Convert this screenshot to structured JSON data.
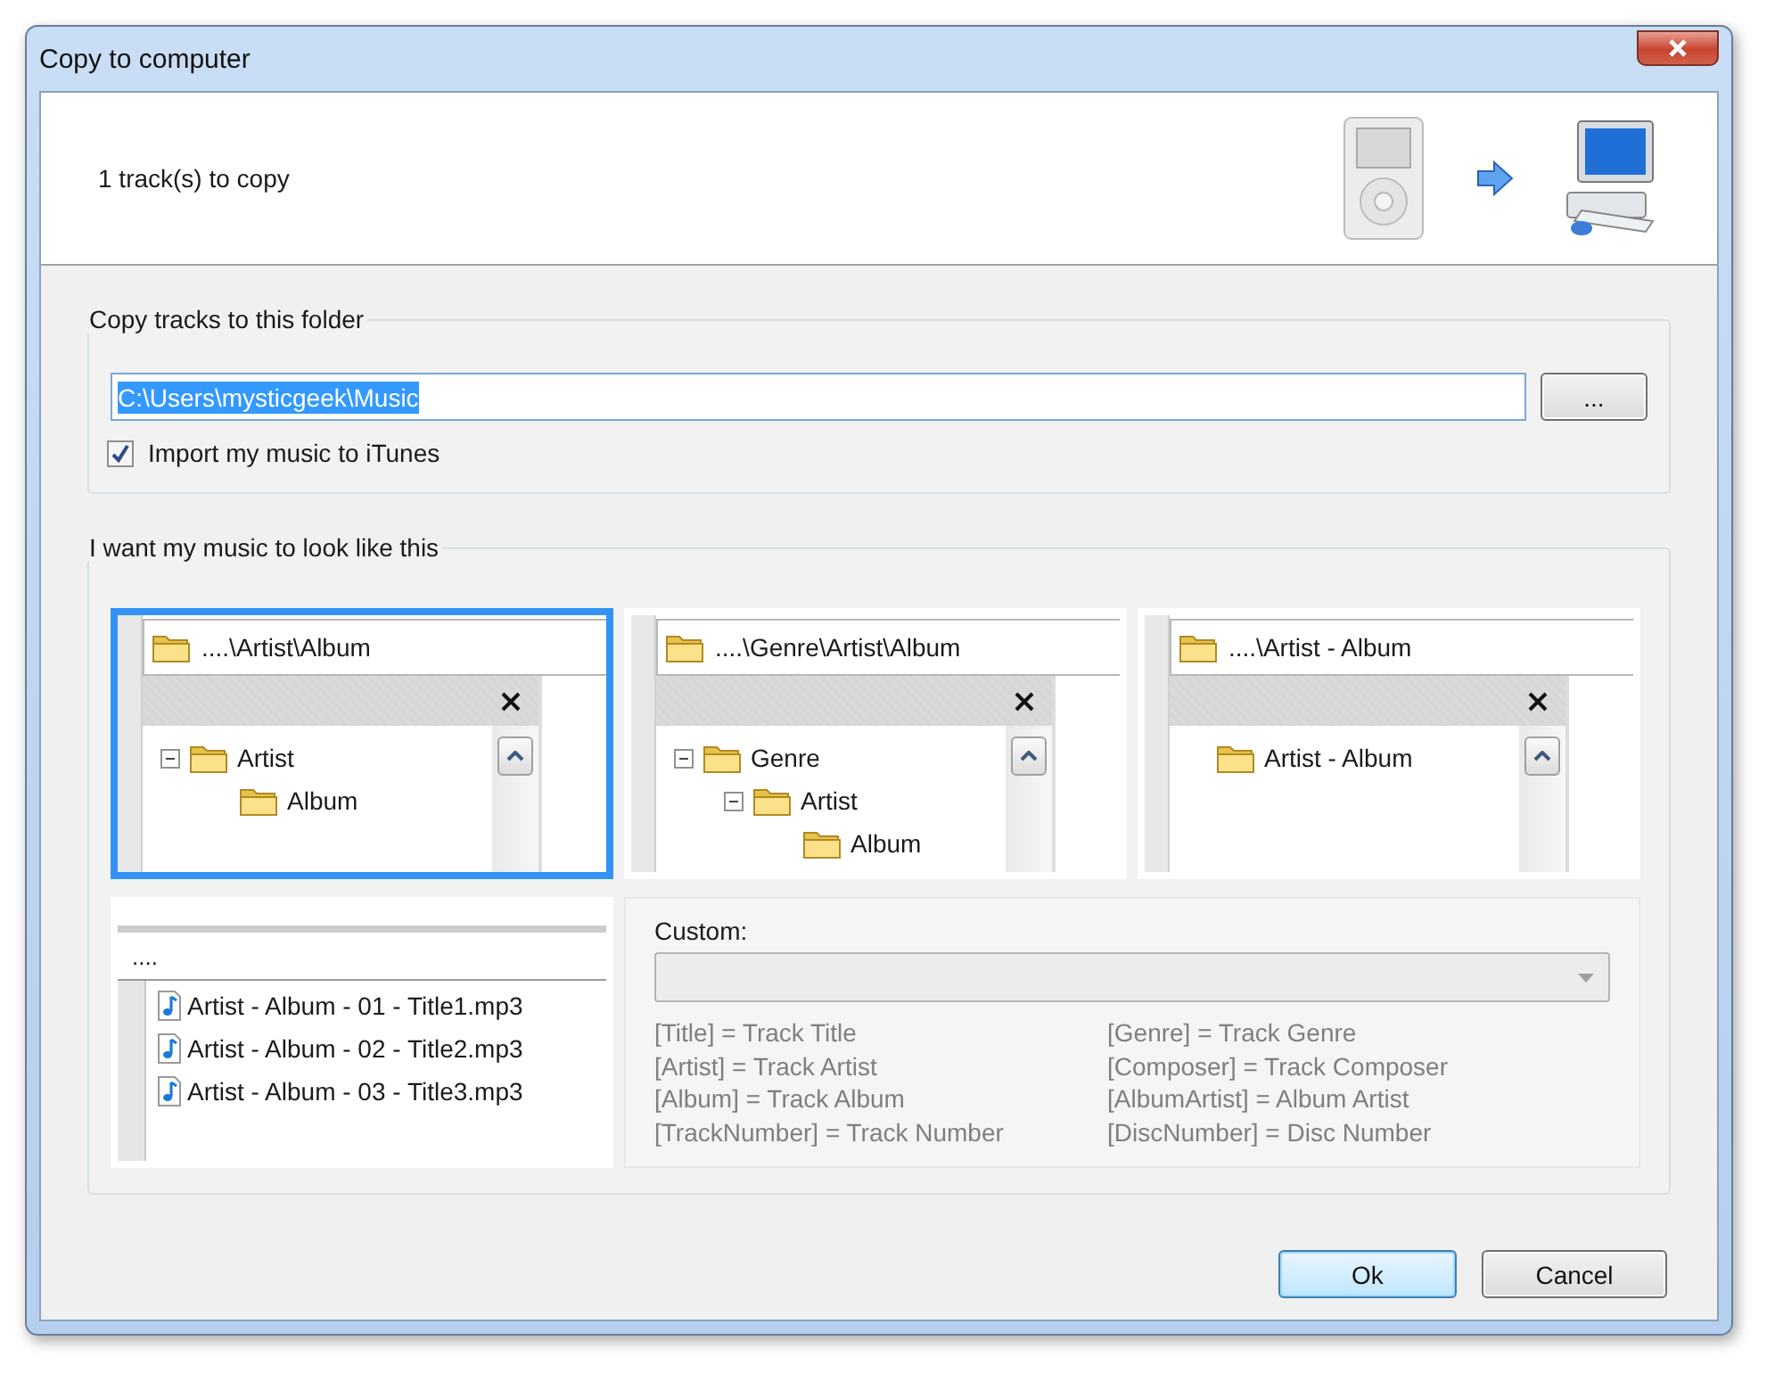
{
  "window": {
    "title": "Copy to computer"
  },
  "header": {
    "summary": "1 track(s) to copy"
  },
  "folder_group": {
    "legend": "Copy tracks to this folder",
    "path": "C:\\Users\\mysticgeek\\Music",
    "path_selected": true,
    "browse_label": "...",
    "import_checkbox": {
      "label": "Import my music to iTunes",
      "checked": true
    }
  },
  "layout_group": {
    "legend": "I want my music to look like this",
    "options": [
      {
        "path": "....\\Artist\\Album",
        "selected": true,
        "tree": [
          {
            "label": "Artist",
            "expanded": true,
            "children": [
              {
                "label": "Album"
              }
            ]
          }
        ]
      },
      {
        "path": "....\\Genre\\Artist\\Album",
        "selected": false,
        "tree": [
          {
            "label": "Genre",
            "expanded": true,
            "children": [
              {
                "label": "Artist",
                "expanded": true,
                "children": [
                  {
                    "label": "Album"
                  }
                ]
              }
            ]
          }
        ]
      },
      {
        "path": "....\\Artist - Album",
        "selected": false,
        "tree": [
          {
            "label": "Artist - Album"
          }
        ]
      }
    ],
    "file_preview": {
      "path": "....",
      "files": [
        "Artist - Album - 01 - Title1.mp3",
        "Artist - Album - 02 - Title2.mp3",
        "Artist - Album - 03 - Title3.mp3"
      ]
    },
    "custom": {
      "label": "Custom:",
      "columns": [
        [
          "[Title] = Track Title",
          "[Artist] = Track Artist",
          "[Album] = Track Album",
          "[TrackNumber] = Track Number"
        ],
        [
          "[Genre] = Track Genre",
          "[Composer] = Track Composer",
          "[AlbumArtist] = Album Artist",
          "[DiscNumber] = Disc Number"
        ]
      ]
    }
  },
  "buttons": [
    {
      "label": "Ok",
      "default": true
    },
    {
      "label": "Cancel",
      "default": false
    }
  ]
}
